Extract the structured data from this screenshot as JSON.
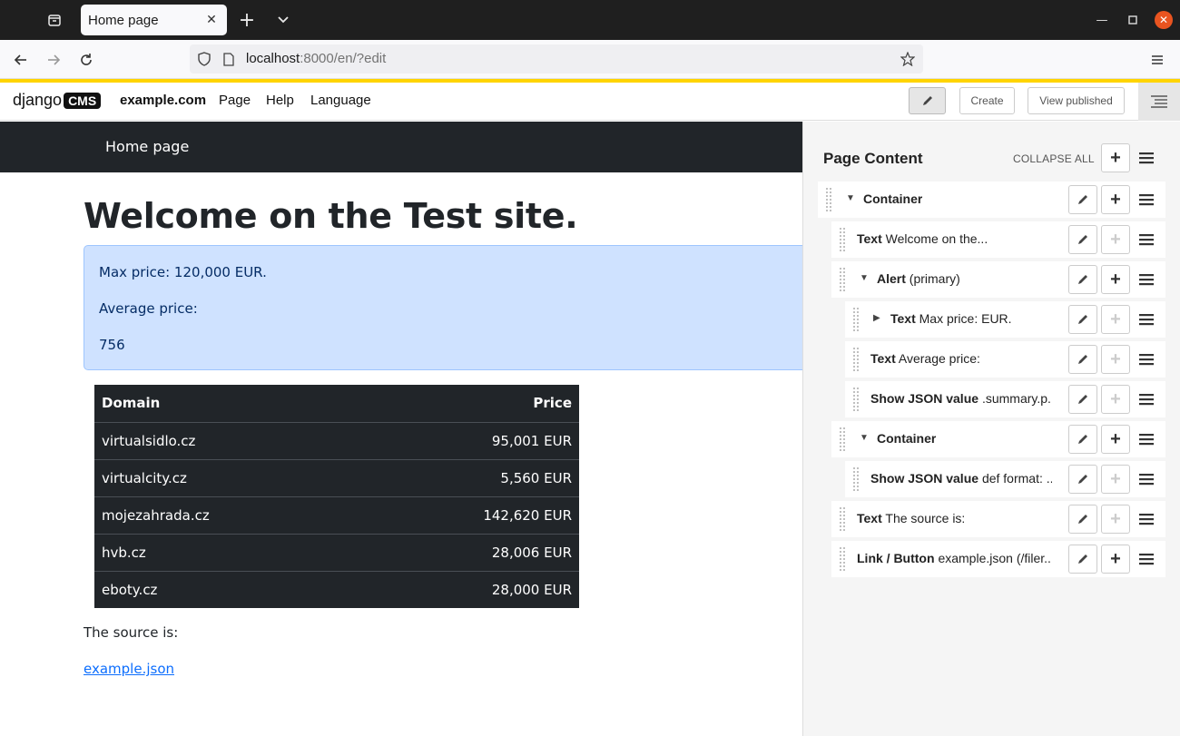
{
  "browser": {
    "tab_title": "Home page",
    "url_host": "localhost",
    "url_rest": ":8000/en/?edit"
  },
  "cms_toolbar": {
    "logo_text": "django",
    "logo_badge": "CMS",
    "site": "example.com",
    "menu": [
      "Page",
      "Help",
      "Language"
    ],
    "create_label": "Create",
    "view_published_label": "View published"
  },
  "page": {
    "nav_brand": "Home page",
    "heading": "Welcome on the Test site.",
    "alert": {
      "line1": "Max price: 120,000 EUR.",
      "line2": "Average price:",
      "line3": "756"
    },
    "table": {
      "headers": [
        "Domain",
        "Price"
      ],
      "rows": [
        [
          "virtualsidlo.cz",
          "95,001 EUR"
        ],
        [
          "virtualcity.cz",
          "5,560 EUR"
        ],
        [
          "mojezahrada.cz",
          "142,620 EUR"
        ],
        [
          "hvb.cz",
          "28,006 EUR"
        ],
        [
          "eboty.cz",
          "28,000 EUR"
        ]
      ]
    },
    "source_text": "The source is:",
    "link_text": "example.json"
  },
  "sidebar": {
    "title": "Page Content",
    "collapse_all": "COLLAPSE ALL",
    "plugins": [
      {
        "name": "Container",
        "desc": ""
      },
      {
        "name": "Text",
        "desc": "Welcome on the..."
      },
      {
        "name": "Alert",
        "desc": "(primary)"
      },
      {
        "name": "Text",
        "desc": "Max price: EUR."
      },
      {
        "name": "Text",
        "desc": "Average price:"
      },
      {
        "name": "Show JSON value",
        "desc": ".summary.p..."
      },
      {
        "name": "Container",
        "desc": ""
      },
      {
        "name": "Show JSON value",
        "desc": "def format: ..."
      },
      {
        "name": "Text",
        "desc": "The source is:"
      },
      {
        "name": "Link / Button",
        "desc": "example.json (/filer..."
      }
    ]
  }
}
